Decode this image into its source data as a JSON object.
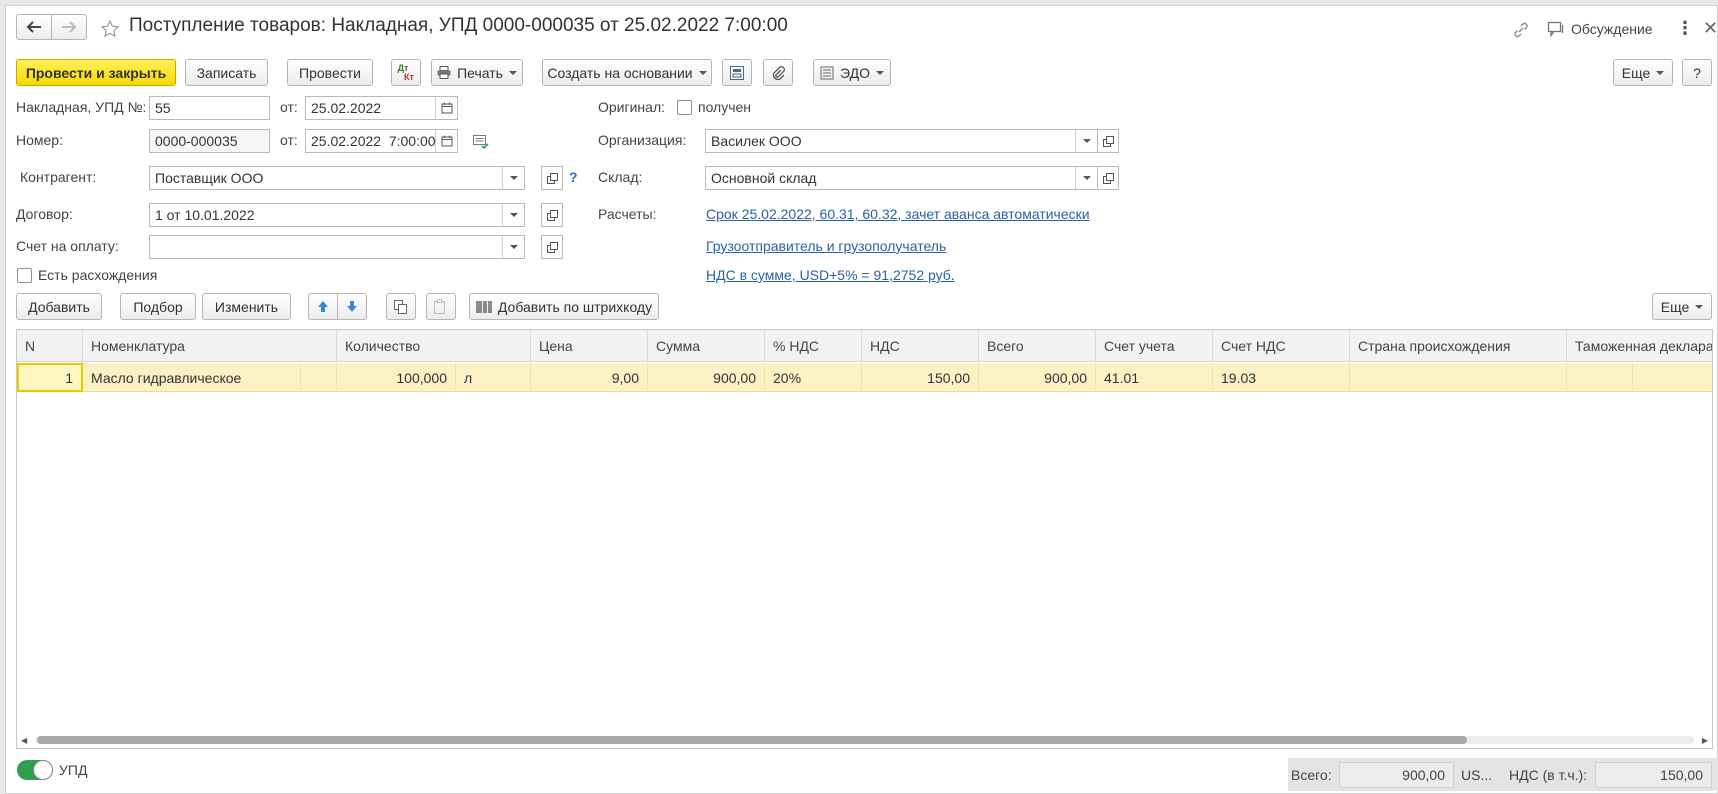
{
  "header": {
    "title": "Поступление товаров: Накладная, УПД 0000-000035 от 25.02.2022 7:00:00",
    "discussion_label": "Обсуждение"
  },
  "toolbar": {
    "post_close": "Провести и закрыть",
    "save": "Записать",
    "post": "Провести",
    "dtkt_top": "Дт",
    "dtkt_bottom": "Кт",
    "print": "Печать",
    "create_based": "Создать на основании",
    "edo": "ЭДО",
    "more": "Еще",
    "help": "?"
  },
  "form": {
    "invoice_label": "Накладная, УПД №:",
    "invoice_value": "55",
    "from_label": "от:",
    "invoice_date": "25.02.2022",
    "number_label": "Номер:",
    "number_value": "0000-000035",
    "number_datetime": "25.02.2022  7:00:00",
    "counterparty_label": "Контрагент:",
    "counterparty_value": "Поставщик ООО",
    "counterparty_help": "?",
    "contract_label": "Договор:",
    "contract_value": "1 от 10.01.2022",
    "payment_invoice_label": "Счет на оплату:",
    "payment_invoice_value": "",
    "discrepancies_label": "Есть расхождения",
    "original_label": "Оригинал:",
    "original_received_label": "получен",
    "organization_label": "Организация:",
    "organization_value": "Василек ООО",
    "warehouse_label": "Склад:",
    "warehouse_value": "Основной склад",
    "settlements_label": "Расчеты:",
    "settlements_link": "Срок 25.02.2022, 60.31, 60.32, зачет аванса автоматически",
    "shipper_link": "Грузоотправитель и грузополучатель",
    "vat_link": "НДС в сумме, USD+5% = 91,2752 руб."
  },
  "table_toolbar": {
    "add": "Добавить",
    "pick": "Подбор",
    "change": "Изменить",
    "add_barcode": "Добавить по штрихкоду",
    "more": "Еще"
  },
  "table": {
    "columns": [
      "N",
      "Номенклатура",
      "Количество",
      "Цена",
      "Сумма",
      "% НДС",
      "НДС",
      "Всего",
      "Счет учета",
      "Счет НДС",
      "Страна происхождения",
      "Таможенная деклараци"
    ],
    "rows": [
      {
        "n": "1",
        "item": "Масло гидравлическое",
        "qty": "100,000",
        "unit": "л",
        "price": "9,00",
        "sum": "900,00",
        "vat_rate": "20%",
        "vat": "150,00",
        "total": "900,00",
        "account": "41.01",
        "vat_account": "19.03",
        "country": "",
        "customs": ""
      }
    ]
  },
  "footer": {
    "upd_label": "УПД",
    "upd_on": true,
    "total_label": "Всего:",
    "total_value": "900,00",
    "currency": "US...",
    "vat_label": "НДС (в т.ч.):",
    "vat_value": "150,00"
  },
  "colors": {
    "accent_yellow": "#f6d800",
    "link_blue": "#2b5fa6",
    "row_highlight": "#fbf1c4",
    "toggle_green": "#2e9e4f"
  }
}
